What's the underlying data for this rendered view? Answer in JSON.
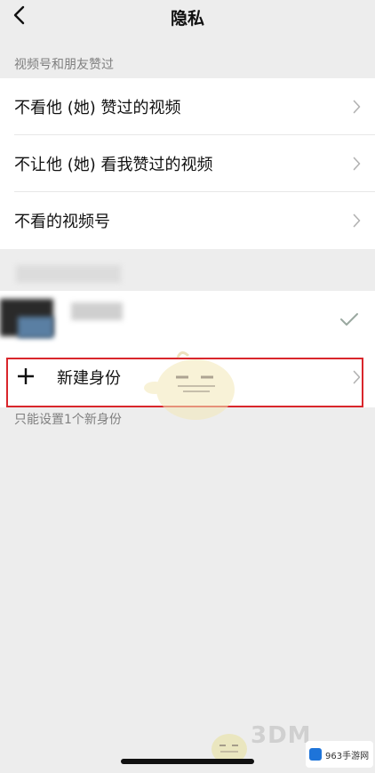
{
  "nav": {
    "title": "隐私",
    "back_icon": "chevron-left-icon"
  },
  "section": {
    "header": "视频号和朋友赞过",
    "items": [
      {
        "label": "不看他 (她) 赞过的视频"
      },
      {
        "label": "不让他 (她) 看我赞过的视频"
      },
      {
        "label": "不看的视频号"
      }
    ]
  },
  "identity": {
    "current_selected": true,
    "new_identity_label": "新建身份",
    "hint": "只能设置1个新身份",
    "highlight_color": "#d9262c"
  },
  "watermark": {
    "text_3dm": "3DM",
    "site_label": "963手游网"
  },
  "colors": {
    "background": "#ededed",
    "row_background": "#ffffff",
    "secondary_text": "#7f7f7f",
    "check": "#9aa8a0"
  }
}
